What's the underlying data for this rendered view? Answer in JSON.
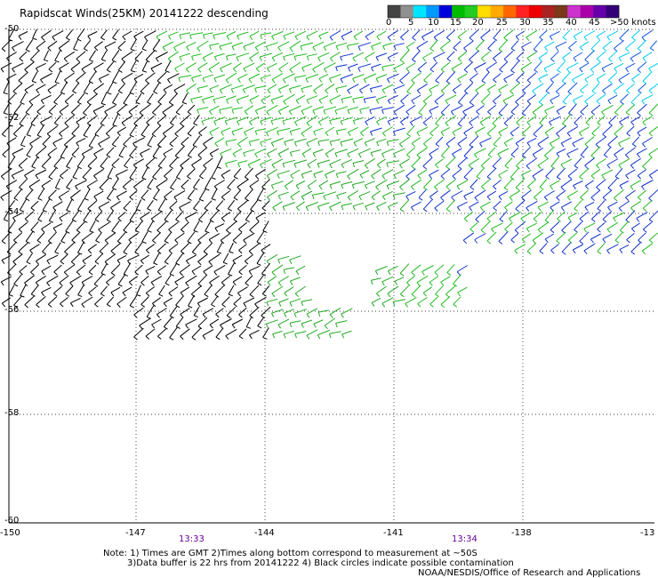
{
  "title": "Rapidscat Winds(25KM) 20141222 descending",
  "color_scale": {
    "labels": [
      "0",
      "5",
      "10",
      "15",
      "20",
      "25",
      "30",
      "35",
      "40",
      "45",
      ">50 knots"
    ],
    "colors": [
      "#444444",
      "#909090",
      "#00e5ff",
      "#0099ff",
      "#0000dd",
      "#00bb00",
      "#22cc22",
      "#ffdd00",
      "#ffaa00",
      "#ff6600",
      "#ff2222",
      "#ee0000",
      "#aa2222",
      "#7a3a1a",
      "#cc33cc",
      "#aa00aa",
      "#6600aa",
      "#330077"
    ]
  },
  "axes": {
    "lat_labels": [
      "-50",
      "-52",
      "-54",
      "-56",
      "-58",
      "-60"
    ],
    "lon_labels": [
      "-150",
      "-147",
      "-144",
      "-141",
      "-138",
      "-13"
    ]
  },
  "time_labels": [
    "13:33",
    "13:34"
  ],
  "notes": [
    "Note: 1) Times are GMT 2)Times along bottom correspond to measurement at ~50S",
    "3)Data buffer is 22 hrs from 20141222 4) Black circles indicate possible contamination",
    "NOAA/NESDIS/Office of Research and Applications"
  ],
  "map_data": {
    "lon_range": [
      -150,
      -135
    ],
    "lat_range": [
      -60,
      -50
    ],
    "grid": true,
    "wind_color_categories": [
      "black",
      "green",
      "blue",
      "cyan"
    ]
  }
}
